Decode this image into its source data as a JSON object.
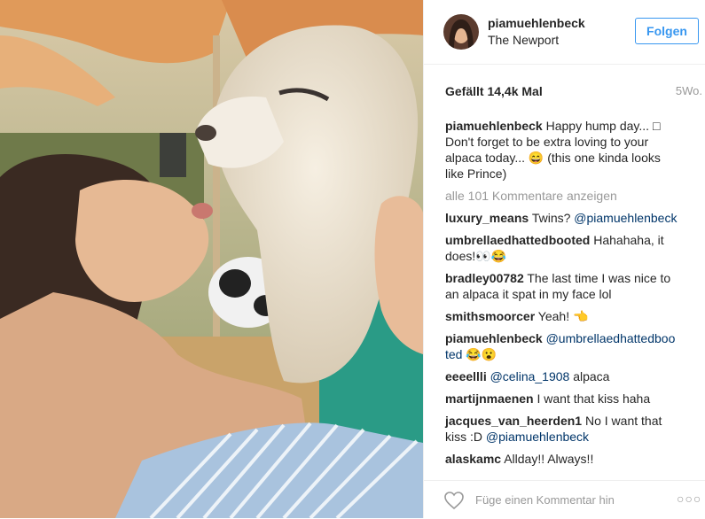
{
  "post": {
    "username": "piamuehlenbeck",
    "location": "The Newport",
    "follow_label": "Folgen",
    "likes": "Gefällt 14,4k Mal",
    "age": "5Wo.",
    "caption_user": "piamuehlenbeck",
    "caption_text": "Happy hump day... □ Don't forget to be extra loving to your alpaca today... 😄 (this one kinda looks like Prince)",
    "view_all": "alle 101 Kommentare anzeigen",
    "add_comment_placeholder": "Füge einen Kommentar hin",
    "more_label": "○○○"
  },
  "comments": [
    {
      "user": "luxury_means",
      "text": "Twins? ",
      "mention": "@piamuehlenbeck",
      "after": ""
    },
    {
      "user": "umbrellaedhattedbooted",
      "text": "Hahahaha, it does!👀😂",
      "mention": "",
      "after": ""
    },
    {
      "user": "bradley00782",
      "text": "The last time I was nice to an alpaca it spat in my face lol",
      "mention": "",
      "after": ""
    },
    {
      "user": "smithsmoorcer",
      "text": "Yeah! 👈",
      "mention": "",
      "after": ""
    },
    {
      "user": "piamuehlenbeck",
      "text": "",
      "mention": "@umbrellaedhattedbooted",
      "after": " 😂😮"
    },
    {
      "user": "eeeellli",
      "text": "",
      "mention": "@celina_1908",
      "after": " alpaca"
    },
    {
      "user": "martijnmaenen",
      "text": "I want that kiss haha",
      "mention": "",
      "after": ""
    },
    {
      "user": "jacques_van_heerden1",
      "text": "No I want that kiss :D ",
      "mention": "@piamuehlenbeck",
      "after": ""
    },
    {
      "user": "alaskamc",
      "text": "Allday!! Always!!",
      "mention": "",
      "after": ""
    }
  ],
  "colors": {
    "accent": "#3897f0",
    "muted": "#999999",
    "mention": "#003569"
  },
  "icons": [
    "heart-icon",
    "more-options-icon"
  ]
}
